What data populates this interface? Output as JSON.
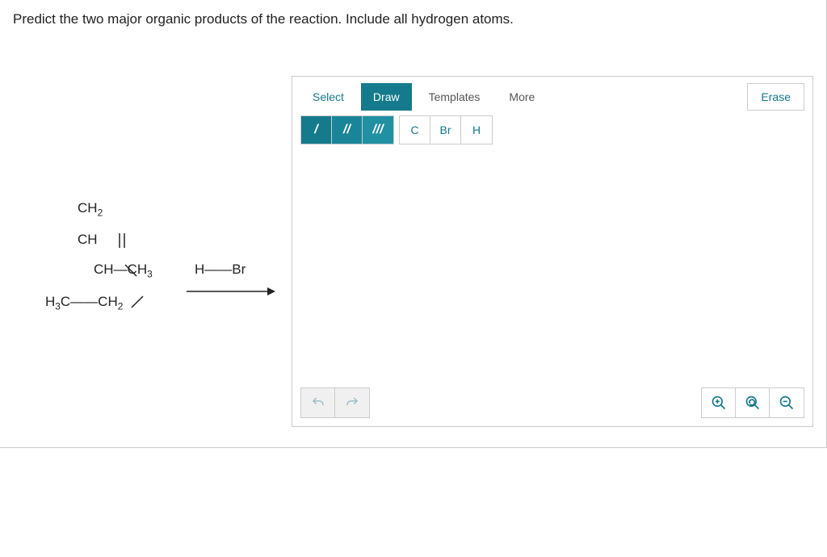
{
  "prompt": "Predict the two major organic products of the reaction. Include all hydrogen atoms.",
  "reagent_label": "H——Br",
  "molecule": {
    "l1": "CH",
    "l1sub": "2",
    "l2": "CH",
    "l3": "CH—CH",
    "l3sub": "3",
    "l4a": "H",
    "l4asub": "3",
    "l4b": "C——CH",
    "l4bsub": "2"
  },
  "toolbar": {
    "select": "Select",
    "draw": "Draw",
    "templates": "Templates",
    "more": "More",
    "erase": "Erase"
  },
  "bonds": {
    "single": "/",
    "double": "//",
    "triple": "///"
  },
  "atoms": {
    "c": "C",
    "br": "Br",
    "h": "H"
  },
  "colors": {
    "accent": "#157a8c"
  }
}
